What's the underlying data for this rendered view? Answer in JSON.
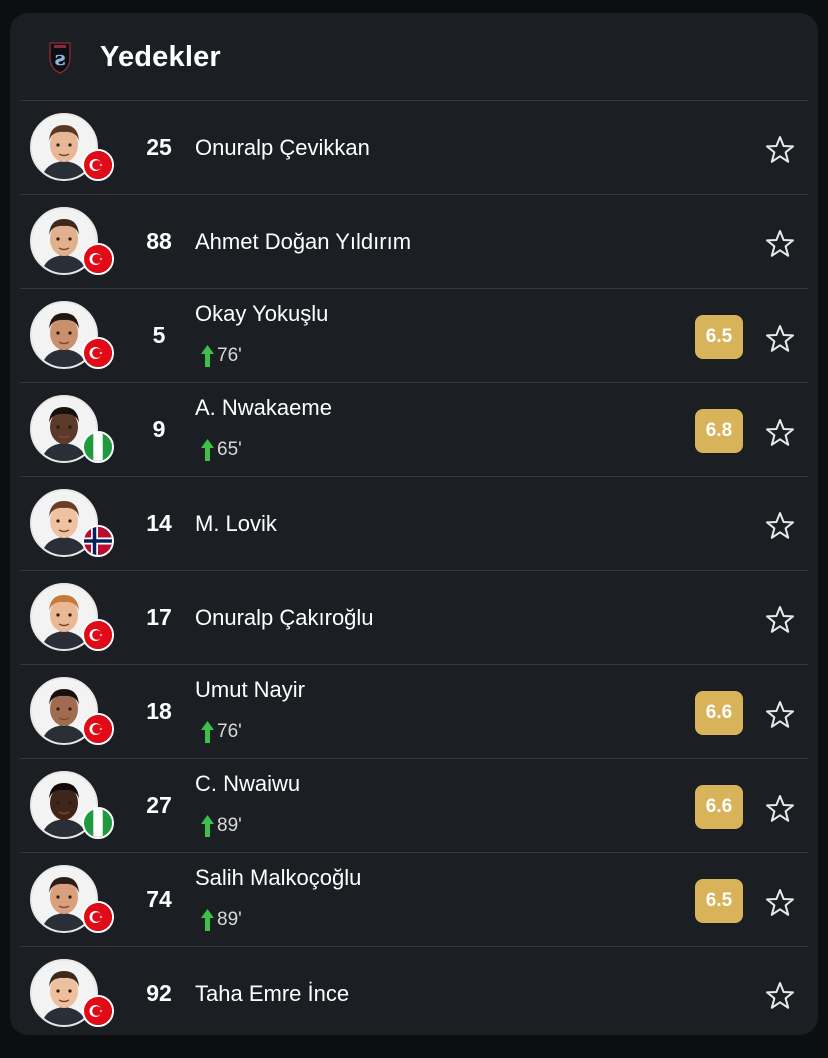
{
  "header": {
    "title": "Yedekler",
    "logo_icon": "team-crest-icon"
  },
  "players": [
    {
      "number": "25",
      "name": "Onuralp Çevikkan",
      "flag": "turkey",
      "rating": null,
      "sub_minute": null
    },
    {
      "number": "88",
      "name": "Ahmet Doğan Yıldırım",
      "flag": "turkey",
      "rating": null,
      "sub_minute": null
    },
    {
      "number": "5",
      "name": "Okay Yokuşlu",
      "flag": "turkey",
      "rating": "6.5",
      "sub_minute": "76'"
    },
    {
      "number": "9",
      "name": "A. Nwakaeme",
      "flag": "nigeria",
      "rating": "6.8",
      "sub_minute": "65'"
    },
    {
      "number": "14",
      "name": "M. Lovik",
      "flag": "norway",
      "rating": null,
      "sub_minute": null
    },
    {
      "number": "17",
      "name": "Onuralp Çakıroğlu",
      "flag": "turkey",
      "rating": null,
      "sub_minute": null
    },
    {
      "number": "18",
      "name": "Umut Nayir",
      "flag": "turkey",
      "rating": "6.6",
      "sub_minute": "76'"
    },
    {
      "number": "27",
      "name": "C. Nwaiwu",
      "flag": "nigeria",
      "rating": "6.6",
      "sub_minute": "89'"
    },
    {
      "number": "74",
      "name": "Salih Malkoçoğlu",
      "flag": "turkey",
      "rating": "6.5",
      "sub_minute": "89'"
    },
    {
      "number": "92",
      "name": "Taha Emre İnce",
      "flag": "turkey",
      "rating": null,
      "sub_minute": null
    }
  ],
  "colors": {
    "card_bg": "#1b1e22",
    "rating_bg": "#d8b35a",
    "sub_arrow": "#3cc04a",
    "divider": "#33373d"
  }
}
